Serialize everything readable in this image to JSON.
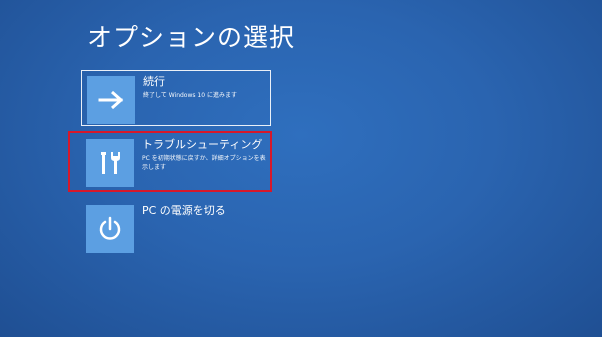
{
  "page": {
    "title": "オプションの選択"
  },
  "options": [
    {
      "title": "続行",
      "description": "終了して Windows 10 に進みます",
      "icon": "arrow-right-icon"
    },
    {
      "title": "トラブルシューティング",
      "description": "PC を初期状態に戻すか、詳細オプションを表示します",
      "icon": "tools-icon"
    },
    {
      "title": "PC の電源を切る",
      "description": "",
      "icon": "power-icon"
    }
  ],
  "colors": {
    "background": "#2a64b0",
    "tile": "#5c9fe2",
    "highlight_border": "#d7182a",
    "text": "#ffffff"
  }
}
